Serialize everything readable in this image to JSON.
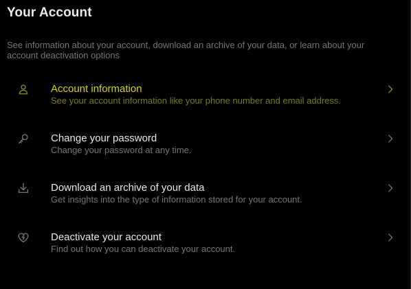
{
  "page": {
    "title": "Your Account",
    "description": "See information about your account, download an archive of your data, or learn about your account deactivation options"
  },
  "colors": {
    "background": "#000000",
    "active_label": "#d4d40f",
    "active_sub": "#7a7a1e",
    "icon_active": "#8a8a28",
    "icon_default": "#71767b",
    "text_primary": "#e7e9ea",
    "text_secondary": "#71767b"
  },
  "menu": {
    "items": [
      {
        "icon": "person-icon",
        "label": "Account information",
        "description": "See your account information like your phone number and email address.",
        "active": true
      },
      {
        "icon": "key-icon",
        "label": "Change your password",
        "description": "Change your password at any time.",
        "active": false
      },
      {
        "icon": "download-icon",
        "label": "Download an archive of your data",
        "description": "Get insights into the type of information stored for your account.",
        "active": false
      },
      {
        "icon": "broken-heart-icon",
        "label": "Deactivate your account",
        "description": "Find out how you can deactivate your account.",
        "active": false
      }
    ]
  }
}
